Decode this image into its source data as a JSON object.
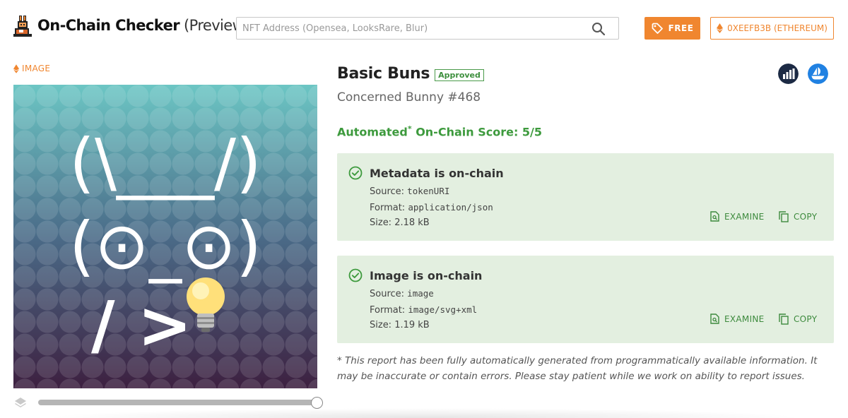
{
  "header": {
    "brand_bold": "On-Chain Checker",
    "brand_light": "(Preview)",
    "search_placeholder": "NFT Address (Opensea, LooksRare, Blur)",
    "free_label": "FREE",
    "wallet_label": "0XEEFB3B (ETHEREUM)"
  },
  "image_panel": {
    "label": "IMAGE",
    "art_row1": "(\\___/)",
    "art_row2": "(⊙_⊙)",
    "art_row3": "/ >",
    "art_emoji": "lightbulb-icon",
    "background_top": "#6cc6c4",
    "background_bottom": "#3d2040"
  },
  "nft": {
    "collection": "Basic Buns",
    "status": "Approved",
    "token_name": "Concerned Bunny #468"
  },
  "score": {
    "prefix": "Automated",
    "star": "*",
    "suffix": "On-Chain Score: 5/5"
  },
  "cards": [
    {
      "title": "Metadata is on-chain",
      "source_label": "Source:",
      "source_value": "tokenURI",
      "format_label": "Format:",
      "format_value": "application/json",
      "size": "Size: 2.18 kB",
      "examine": "EXAMINE",
      "copy": "COPY"
    },
    {
      "title": "Image is on-chain",
      "source_label": "Source:",
      "source_value": "image",
      "format_label": "Format:",
      "format_value": "image/svg+xml",
      "size": "Size: 1.19 kB",
      "examine": "EXAMINE",
      "copy": "COPY"
    }
  ],
  "footnote": "* This report has been fully automatically generated from programmatically available information. It may be inaccurate or contain errors. Please stay patient while we work on ability to report issues.",
  "colors": {
    "accent": "#f0862f",
    "success": "#3d9a3d",
    "card_bg": "#e3efe0"
  },
  "image_slider": {
    "position": 1.0
  }
}
